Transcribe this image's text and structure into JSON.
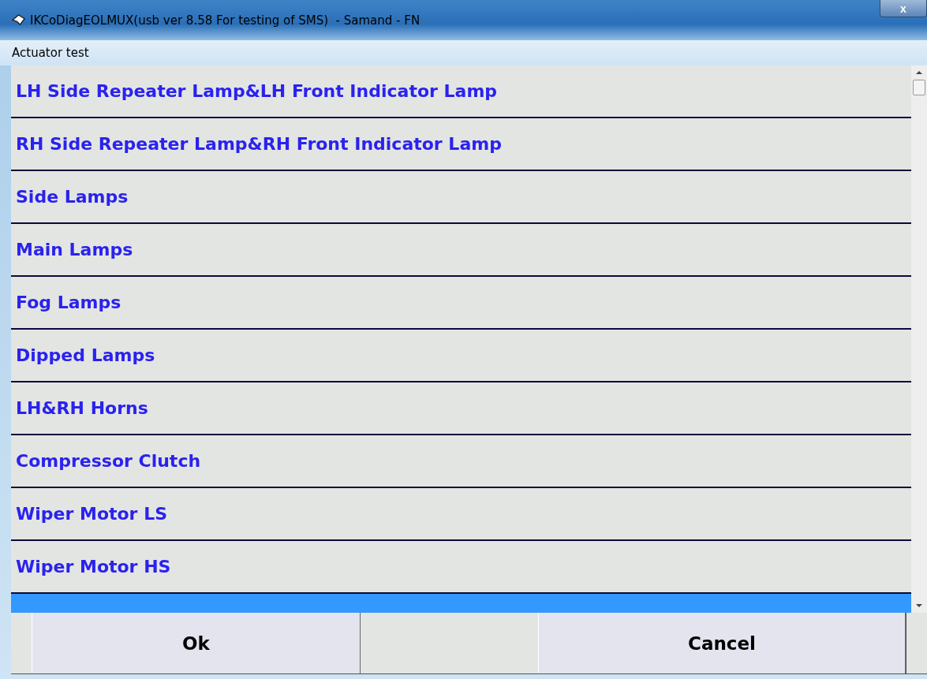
{
  "window": {
    "title": "IKCoDiagEOLMUX(usb ver 8.58 For testing of SMS)  - Samand - FN",
    "close": "x"
  },
  "section": {
    "title": "Actuator test"
  },
  "list": {
    "items": [
      {
        "label": "LH Side Repeater Lamp&LH Front Indicator Lamp",
        "selected": false
      },
      {
        "label": "RH Side Repeater Lamp&RH Front Indicator Lamp",
        "selected": false
      },
      {
        "label": "Side Lamps",
        "selected": false
      },
      {
        "label": "Main Lamps",
        "selected": false
      },
      {
        "label": "Fog Lamps",
        "selected": false
      },
      {
        "label": "Dipped Lamps",
        "selected": false
      },
      {
        "label": "LH&RH Horns",
        "selected": false
      },
      {
        "label": "Compressor Clutch",
        "selected": false
      },
      {
        "label": "Wiper Motor LS",
        "selected": false
      },
      {
        "label": "Wiper Motor HS",
        "selected": false
      },
      {
        "selected": true
      }
    ]
  },
  "buttons": [
    {
      "label": "Ok"
    },
    {
      "label": "Cancel"
    }
  ]
}
